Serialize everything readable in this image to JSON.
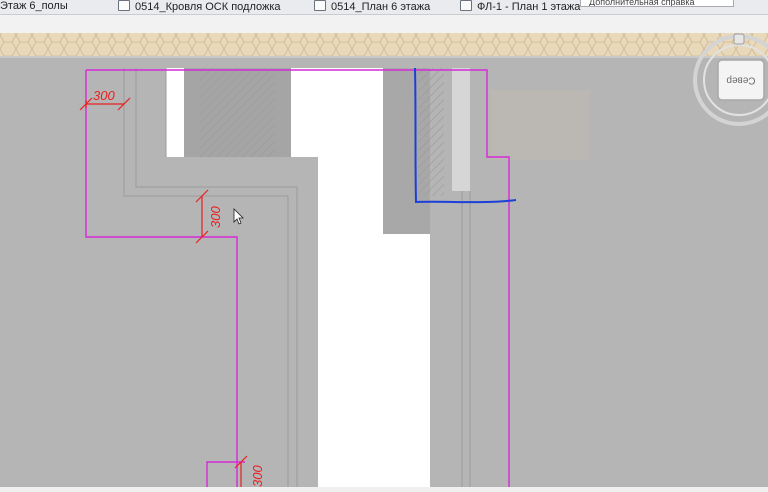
{
  "tabs": [
    {
      "label": "Этаж 6_полы",
      "icon": "view-tab-icon",
      "active": false
    },
    {
      "label": "0514_Кровля ОСК подложка",
      "icon": "view-tab-icon",
      "active": false
    },
    {
      "label": "0514_План 6 этажа",
      "icon": "view-tab-icon",
      "active": false
    },
    {
      "label": "ФЛ-1 - План 1 этажа",
      "icon": "view-tab-icon",
      "active": true
    }
  ],
  "tooltip": {
    "text": "Дополнительная справка"
  },
  "viewcube": {
    "face_label": "Север"
  },
  "dimensions": [
    {
      "value": "300"
    },
    {
      "value": "300"
    },
    {
      "value": "300"
    }
  ],
  "colors": {
    "background": "#b4b4b4",
    "wall": "#a9a9a9",
    "opening": "#ffffff",
    "roof_band": "#e5d4b6",
    "magenta_outline": "#d62ad6",
    "dimension_red": "#e62222",
    "sketch_blue": "#1c3fd8"
  }
}
